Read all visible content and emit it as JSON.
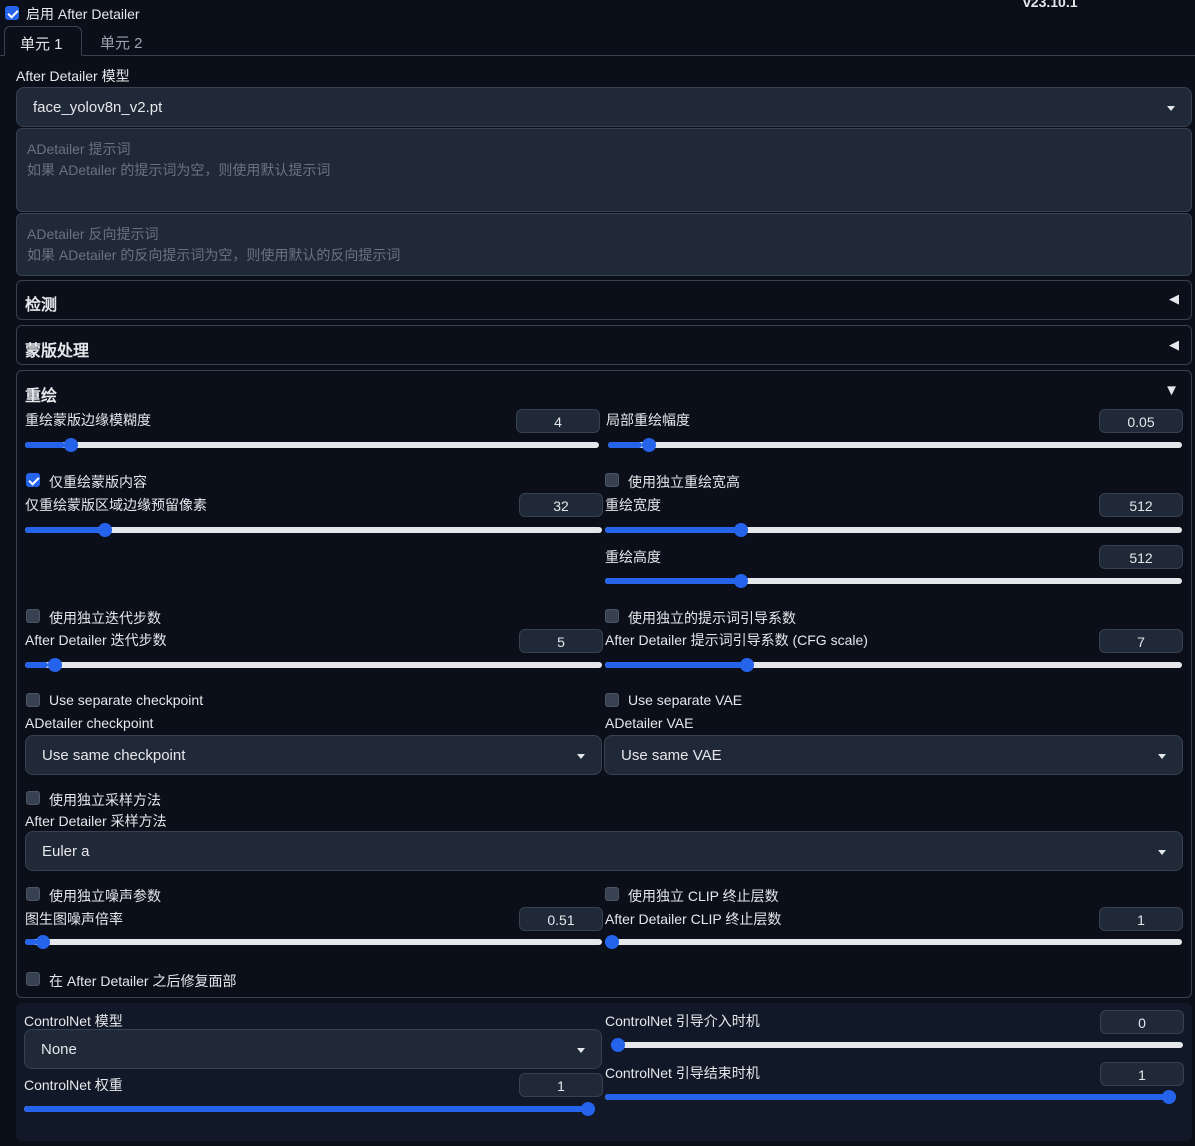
{
  "enable": {
    "label": "启用 After Detailer",
    "checked": true
  },
  "version": "v23.10.1",
  "tabs": [
    {
      "label": "单元 1",
      "active": true
    },
    {
      "label": "单元 2",
      "active": false
    }
  ],
  "model": {
    "label": "After Detailer 模型",
    "value": "face_yolov8n_v2.pt"
  },
  "prompt": {
    "placeholder": "ADetailer 提示词\n如果 ADetailer 的提示词为空，则使用默认提示词"
  },
  "neg_prompt": {
    "placeholder": "ADetailer 反向提示词\n如果 ADetailer 的反向提示词为空，则使用默认的反向提示词"
  },
  "sections": {
    "detection": "检测",
    "mask": "蒙版处理",
    "inpaint": "重绘"
  },
  "inpaint": {
    "mask_blur": {
      "label": "重绘蒙版边缘模糊度",
      "value": "4",
      "fraction": 0.07
    },
    "denoise": {
      "label": "局部重绘幅度",
      "value": "0.05",
      "fraction": 0.06
    },
    "only_masked": {
      "label": "仅重绘蒙版内容",
      "checked": true
    },
    "padding": {
      "label": "仅重绘蒙版区域边缘预留像素",
      "value": "32",
      "fraction": 0.13
    },
    "sep_wh": {
      "label": "使用独立重绘宽高",
      "checked": false
    },
    "width": {
      "label": "重绘宽度",
      "value": "512",
      "fraction": 0.23
    },
    "height": {
      "label": "重绘高度",
      "value": "512",
      "fraction": 0.23
    },
    "sep_steps": {
      "label": "使用独立迭代步数",
      "checked": false
    },
    "steps": {
      "label": "After Detailer 迭代步数",
      "value": "5",
      "fraction": 0.04
    },
    "sep_cfg": {
      "label": "使用独立的提示词引导系数",
      "checked": false
    },
    "cfg": {
      "label": "After Detailer 提示词引导系数 (CFG scale)",
      "value": "7",
      "fraction": 0.24
    },
    "sep_ckpt": {
      "label": "Use separate checkpoint",
      "checked": false
    },
    "sep_vae": {
      "label": "Use separate VAE",
      "checked": false
    },
    "ckpt": {
      "label": "ADetailer checkpoint",
      "value": "Use same checkpoint"
    },
    "vae": {
      "label": "ADetailer VAE",
      "value": "Use same VAE"
    },
    "sep_sampler": {
      "label": "使用独立采样方法",
      "checked": false
    },
    "sampler": {
      "label": "After Detailer 采样方法",
      "value": "Euler a"
    },
    "sep_noise": {
      "label": "使用独立噪声参数",
      "checked": false
    },
    "sep_clip": {
      "label": "使用独立 CLIP 终止层数",
      "checked": false
    },
    "noise": {
      "label": "图生图噪声倍率",
      "value": "0.51",
      "fraction": 0.02
    },
    "clip": {
      "label": "After Detailer CLIP 终止层数",
      "value": "1",
      "fraction": 0.0
    },
    "restore_face": {
      "label": "在 After Detailer 之后修复面部",
      "checked": false
    }
  },
  "controlnet": {
    "model": {
      "label": "ControlNet 模型",
      "value": "None"
    },
    "start": {
      "label": "ControlNet 引导介入时机",
      "value": "0",
      "fraction": 0.0
    },
    "weight": {
      "label": "ControlNet 权重",
      "value": "1",
      "fraction": 1.0
    },
    "end": {
      "label": "ControlNet 引导结束时机",
      "value": "1",
      "fraction": 1.0
    }
  },
  "colors": {
    "accent": "#2563eb",
    "background": "#0b0f19",
    "surface": "#1f2937",
    "border": "#374151"
  }
}
